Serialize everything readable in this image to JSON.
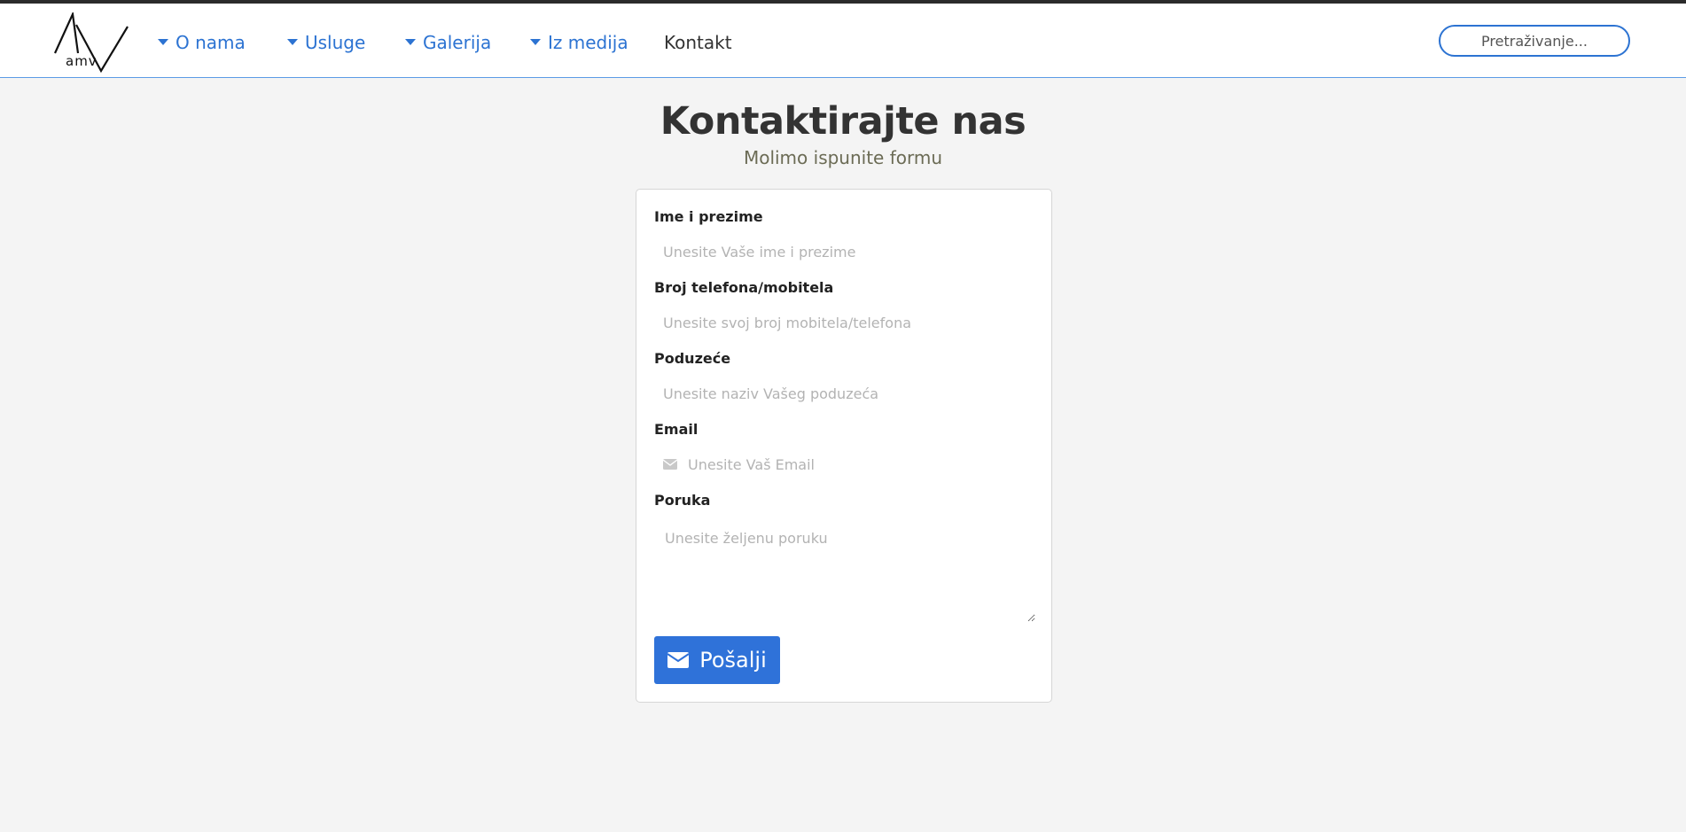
{
  "header": {
    "logo_text": "amv",
    "nav": [
      {
        "label": "O nama",
        "dropdown": true
      },
      {
        "label": "Usluge",
        "dropdown": true
      },
      {
        "label": "Galerija",
        "dropdown": true
      },
      {
        "label": "Iz medija",
        "dropdown": true
      },
      {
        "label": "Kontakt",
        "dropdown": false
      }
    ],
    "search_placeholder": "Pretraživanje..."
  },
  "page": {
    "title": "Kontaktirajte nas",
    "subtitle": "Molimo ispunite formu"
  },
  "form": {
    "name": {
      "label": "Ime i prezime",
      "placeholder": "Unesite Vaše ime i prezime",
      "value": ""
    },
    "phone": {
      "label": "Broj telefona/mobitela",
      "placeholder": "Unesite svoj broj mobitela/telefona",
      "value": ""
    },
    "company": {
      "label": "Poduzeće",
      "placeholder": "Unesite naziv Vašeg poduzeća",
      "value": ""
    },
    "email": {
      "label": "Email",
      "placeholder": "Unesite Vaš Email",
      "value": ""
    },
    "message": {
      "label": "Poruka",
      "placeholder": "Unesite željenu poruku",
      "value": ""
    },
    "submit_label": "Pošalji"
  },
  "colors": {
    "accent": "#2f72d9",
    "background": "#f4f4f4"
  }
}
